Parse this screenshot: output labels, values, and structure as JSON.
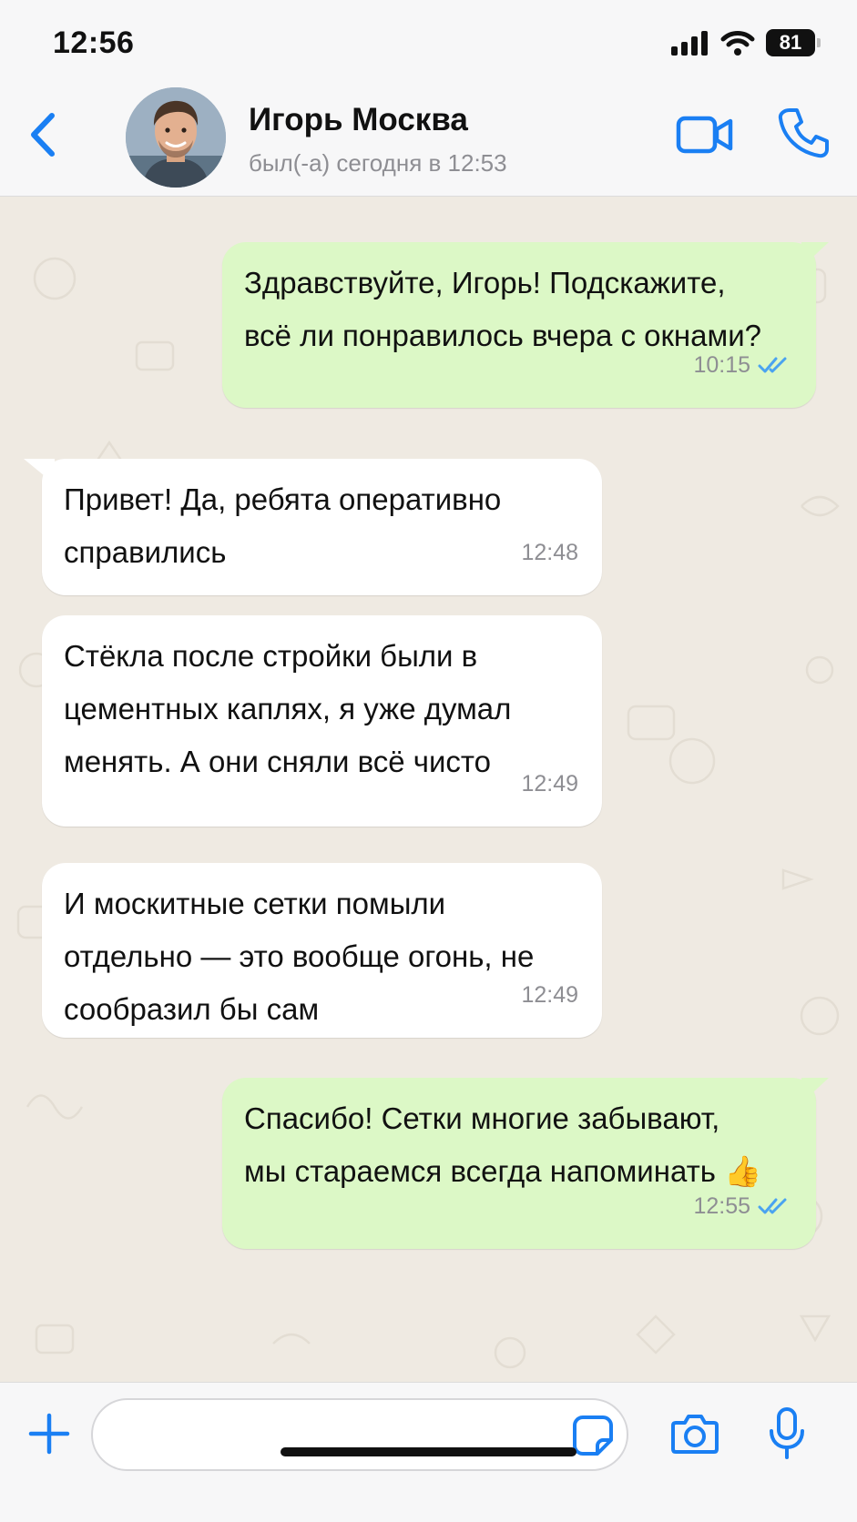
{
  "status_bar": {
    "time": "12:56",
    "battery": "81"
  },
  "header": {
    "contact_name": "Игорь Москва",
    "contact_status": "был(-а) сегодня в 12:53"
  },
  "messages": [
    {
      "direction": "out",
      "text": "Здравствуйте, Игорь! Подскажите,\nвсё ли понравилось вчера с окнами?",
      "time": "10:15",
      "status": "read"
    },
    {
      "direction": "in",
      "text": "Привет! Да, ребята оперативно\nсправились",
      "time": "12:48"
    },
    {
      "direction": "in",
      "text": "Стёкла после стройки были в\nцементных каплях, я уже думал\nменять. А они сняли всё чисто",
      "time": "12:49"
    },
    {
      "direction": "in",
      "text": "И москитные сетки помыли\nотдельно — это вообще огонь, не\nсообразил бы сам",
      "time": "12:49"
    },
    {
      "direction": "out",
      "text": "Спасибо! Сетки многие забывают,\nмы стараемся всегда напоминать 👍",
      "time": "12:55",
      "status": "read"
    }
  ],
  "input": {
    "placeholder": ""
  },
  "colors": {
    "accent": "#1a7ff3",
    "outgoing_bubble": "#dcf8c6",
    "incoming_bubble": "#ffffff",
    "chat_bg": "#efeae2",
    "read_ticks": "#4aa3f0"
  },
  "icons": [
    "back-icon",
    "video-call-icon",
    "phone-icon",
    "plus-icon",
    "sticker-icon",
    "camera-icon",
    "microphone-icon",
    "read-receipt-icon"
  ]
}
